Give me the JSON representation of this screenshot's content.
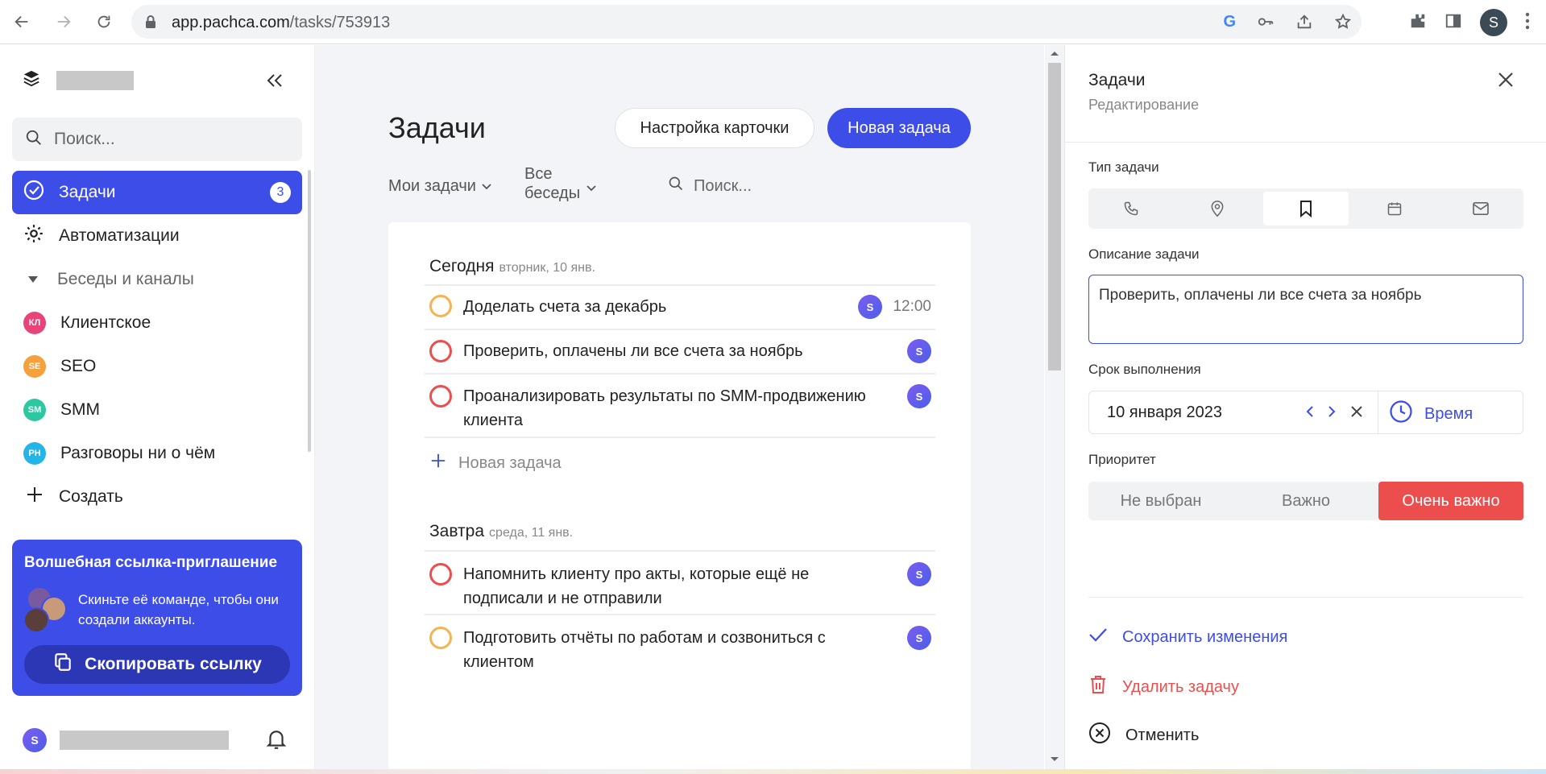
{
  "browser": {
    "url_host": "app.pachca.com",
    "url_path": "/tasks/753913",
    "profile_initial": "S"
  },
  "sidebar": {
    "search_placeholder": "Поиск...",
    "nav": [
      {
        "label": "Задачи",
        "badge": "3",
        "icon": "check-circle-icon",
        "active": true
      },
      {
        "label": "Автоматизации",
        "icon": "gear-icon"
      }
    ],
    "section_title": "Беседы и каналы",
    "channels": [
      {
        "abbr": "КЛ",
        "label": "Клиентское",
        "color": "#e8447a"
      },
      {
        "abbr": "SE",
        "label": "SEO",
        "color": "#f6a03b"
      },
      {
        "abbr": "SM",
        "label": "SMM",
        "color": "#2dc7a1"
      },
      {
        "abbr": "РН",
        "label": "Разговоры ни о чём",
        "color": "#25b4e8"
      }
    ],
    "create_label": "Создать",
    "invite": {
      "title": "Волшебная ссылка-приглашение",
      "description": "Скиньте её команде, чтобы они создали аккаунты.",
      "button": "Скопировать ссылку"
    },
    "user_initial": "S"
  },
  "main": {
    "title": "Задачи",
    "settings_button": "Настройка карточки",
    "new_task_button": "Новая задача",
    "filter_mine": "Мои задачи",
    "filter_chats_1": "Все",
    "filter_chats_2": "беседы",
    "search_placeholder": "Поиск...",
    "today": {
      "title": "Сегодня",
      "date": "вторник, 10 янв.",
      "tasks": [
        {
          "text": "Доделать счета за декабрь",
          "priority": "medium",
          "assignee": "S",
          "time": "12:00"
        },
        {
          "text": "Проверить, оплачены ли все счета за ноябрь",
          "priority": "high",
          "assignee": "S"
        },
        {
          "text": "Проанализировать результаты по SMM-продвижению клиента",
          "priority": "high",
          "assignee": "S"
        }
      ],
      "new_task": "Новая задача"
    },
    "tomorrow": {
      "title": "Завтра",
      "date": "среда, 11 янв.",
      "tasks": [
        {
          "text": "Напомнить клиенту про акты, которые ещё не подписали и не отправили",
          "priority": "high",
          "assignee": "S"
        },
        {
          "text": "Подготовить отчёты по работам и созвониться с клиентом",
          "priority": "medium",
          "assignee": "S"
        }
      ]
    }
  },
  "panel": {
    "title": "Задачи",
    "subtitle": "Редактирование",
    "type_label": "Тип задачи",
    "types": [
      "phone-icon",
      "location-pin-icon",
      "bookmark-icon",
      "calendar-icon",
      "mail-icon"
    ],
    "selected_type": "bookmark-icon",
    "description_label": "Описание задачи",
    "description_value": "Проверить, оплачены ли все счета за ноябрь",
    "deadline_label": "Срок выполнения",
    "deadline_value": "10 января 2023",
    "time_button": "Время",
    "priority_label": "Приоритет",
    "priority_options": [
      "Не выбран",
      "Важно",
      "Очень важно"
    ],
    "priority_selected": "Очень важно",
    "save": "Сохранить изменения",
    "delete": "Удалить задачу",
    "cancel": "Отменить"
  },
  "colors": {
    "accent": "#3d4de8",
    "danger": "#ec4e4e",
    "priority_medium": "#f6b352",
    "priority_high": "#ec4e4e"
  }
}
